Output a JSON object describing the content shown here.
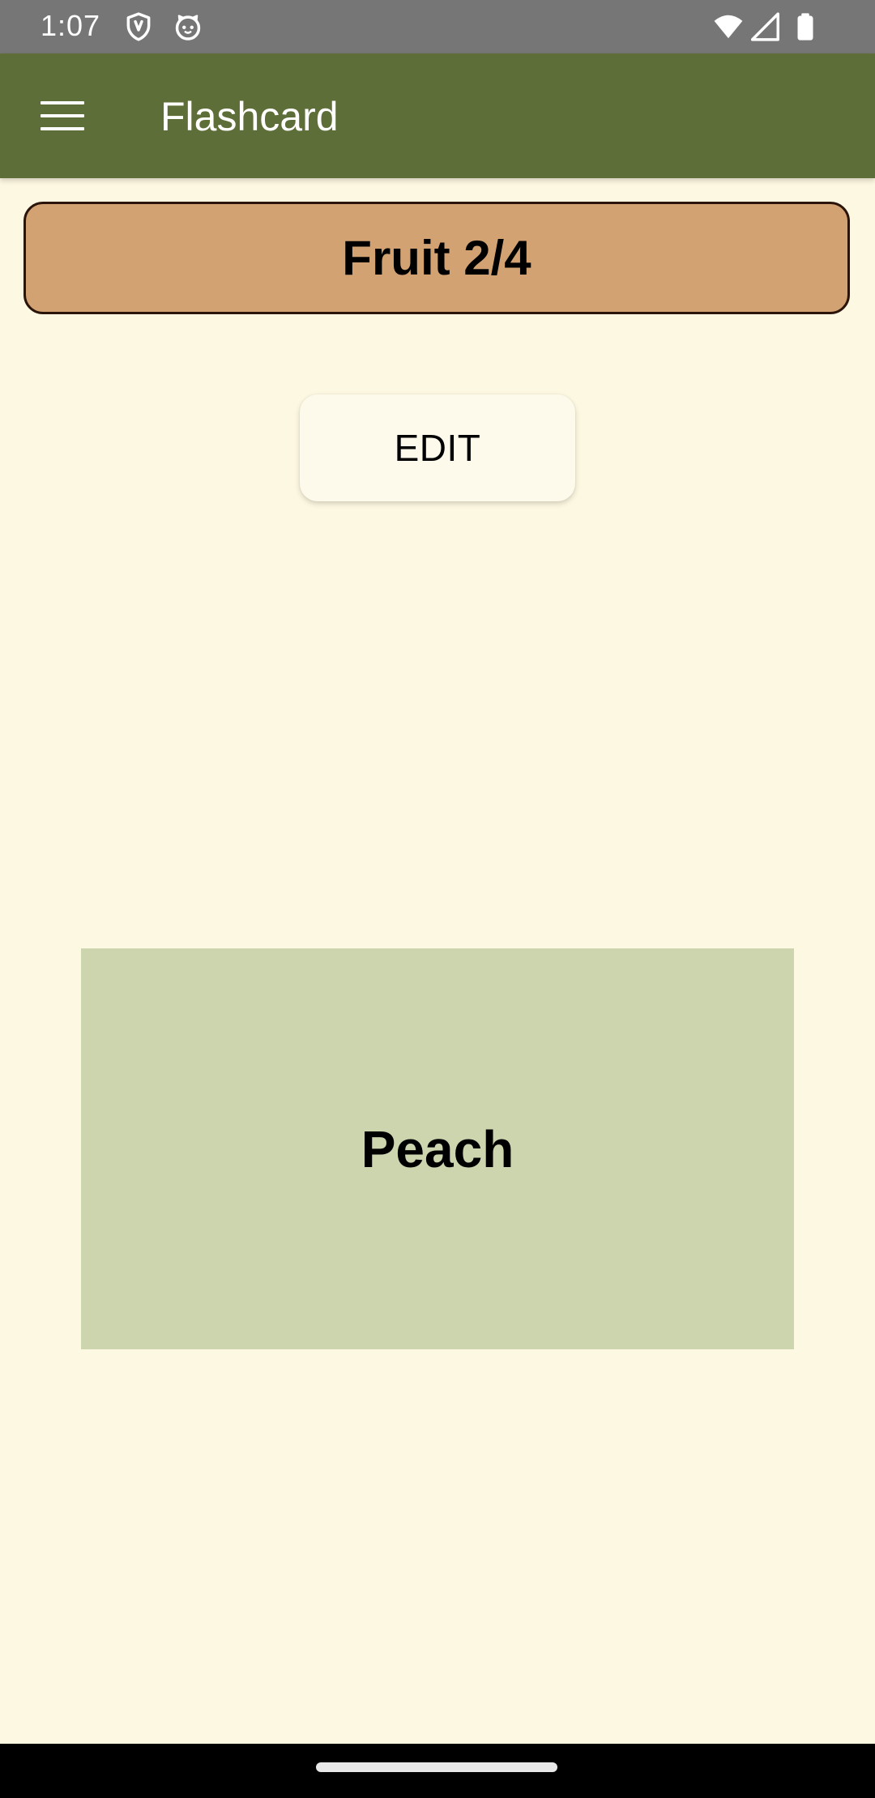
{
  "status_bar": {
    "time": "1:07",
    "icons": [
      "shield-icon",
      "cat-face-icon",
      "wifi-icon",
      "cell-signal-icon",
      "battery-icon"
    ]
  },
  "app_bar": {
    "title": "Flashcard",
    "menu_icon": "hamburger-menu-icon",
    "background_color": "#5e6e38"
  },
  "deck": {
    "title": "Fruit 2/4",
    "background_color": "#d3a273"
  },
  "edit_button": {
    "label": "EDIT"
  },
  "card": {
    "text": "Peach",
    "background_color": "#ccd5ae"
  },
  "colors": {
    "page_background": "#fdf8e1"
  }
}
